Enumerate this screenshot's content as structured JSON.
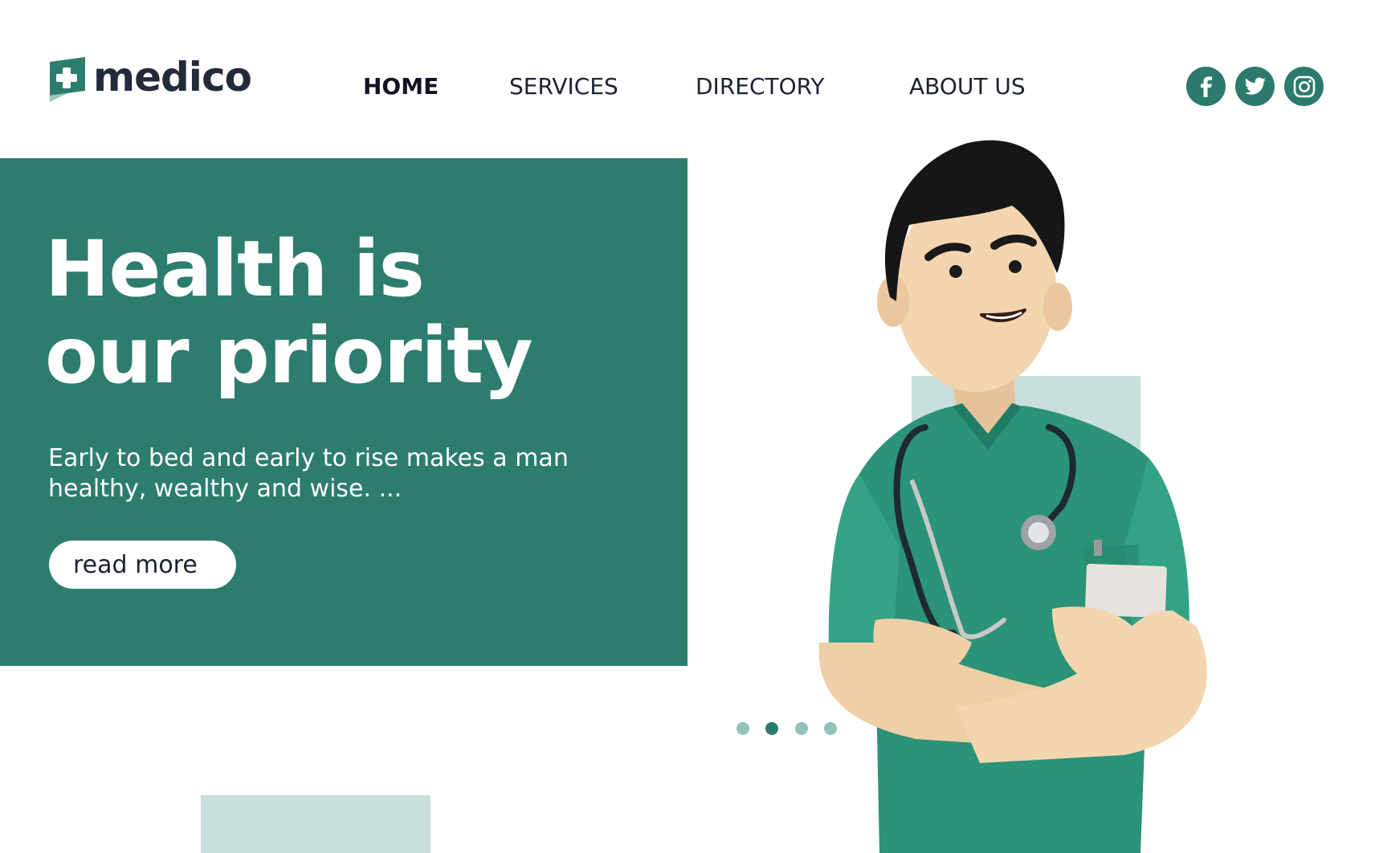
{
  "brand": {
    "name": "medico",
    "icon": "medical-cross-icon",
    "color": "#2c7d6d"
  },
  "nav": {
    "items": [
      {
        "label": "HOME",
        "active": true
      },
      {
        "label": "SERVICES",
        "active": false
      },
      {
        "label": "DIRECTORY",
        "active": false
      },
      {
        "label": "ABOUT US",
        "active": false
      }
    ]
  },
  "social": [
    {
      "icon": "facebook-icon"
    },
    {
      "icon": "twitter-icon"
    },
    {
      "icon": "instagram-icon"
    }
  ],
  "hero": {
    "title_line1": "Health is",
    "title_line2": "our priority",
    "subtitle": "Early to bed and early to rise makes a man healthy, wealthy and wise. ...",
    "cta_label": "read more",
    "background": "#2c7d6d"
  },
  "carousel": {
    "total": 4,
    "active_index": 2
  },
  "colors": {
    "primary": "#2c7d6d",
    "accent_light": "#c9dfdb",
    "dot_inactive": "#93c3b8",
    "text_dark": "#1d2230"
  }
}
